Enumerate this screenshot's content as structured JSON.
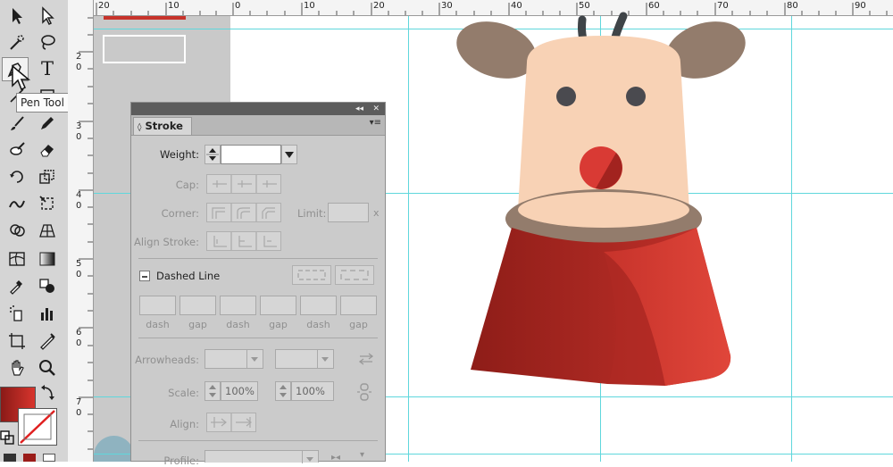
{
  "tools": {
    "tooltip": "Pen Tool (P)",
    "type_tool_glyph": "T"
  },
  "ruler": {
    "top_numbers": [
      "20",
      "10",
      "0",
      "10",
      "20",
      "30",
      "40",
      "50",
      "60",
      "70",
      "80",
      "90"
    ],
    "left_numbers": [
      "2",
      "0",
      "3",
      "0",
      "4",
      "0",
      "5",
      "0",
      "6",
      "0",
      "7",
      "0"
    ]
  },
  "stroke_panel": {
    "collapse_glyph": "◂◂",
    "close_glyph": "✕",
    "menu_glyph": "▾≡",
    "tab_label": "Stroke",
    "tab_arrows": "◊",
    "weight_label": "Weight:",
    "weight_value": "",
    "cap_label": "Cap:",
    "corner_label": "Corner:",
    "limit_label": "Limit:",
    "limit_unit": "x",
    "align_stroke_label": "Align Stroke:",
    "dashed_line_label": "Dashed Line",
    "dash_labels": [
      "dash",
      "gap",
      "dash",
      "gap",
      "dash",
      "gap"
    ],
    "arrowheads_label": "Arrowheads:",
    "scale_label": "Scale:",
    "scale_start": "100%",
    "scale_end": "100%",
    "align_label": "Align:",
    "profile_label": "Profile:"
  },
  "colors": {
    "guide": "#5fd7dc",
    "reindeer_red": "#c7332b",
    "face": "#f8d2b5",
    "ears": "#937c6c"
  }
}
